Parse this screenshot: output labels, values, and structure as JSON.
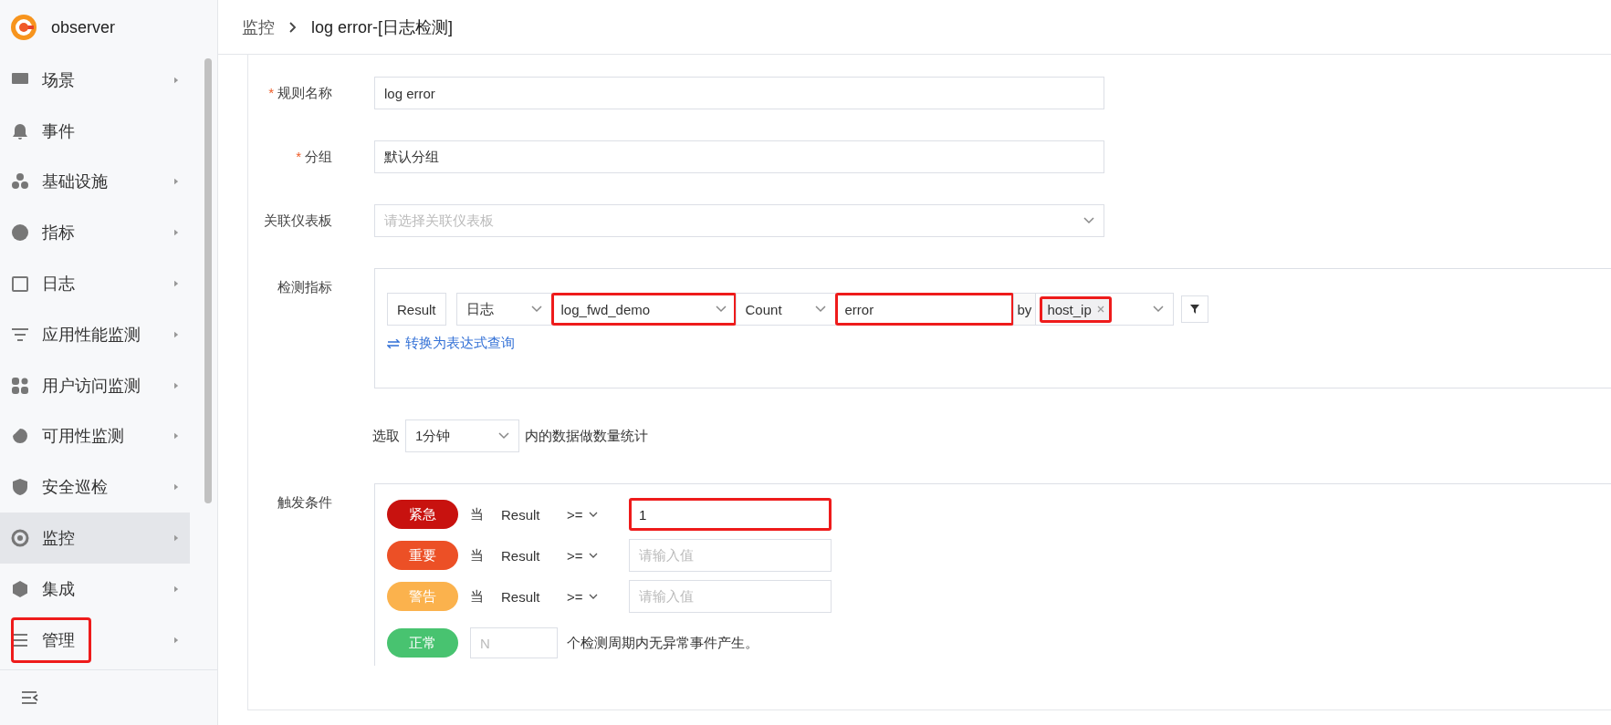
{
  "sidebar": {
    "logo_text": "observer",
    "items": [
      {
        "label": "场景",
        "has_submenu": true,
        "selected": false,
        "highlighted": false
      },
      {
        "label": "事件",
        "has_submenu": false,
        "selected": false,
        "highlighted": false
      },
      {
        "label": "基础设施",
        "has_submenu": true,
        "selected": false,
        "highlighted": false
      },
      {
        "label": "指标",
        "has_submenu": true,
        "selected": false,
        "highlighted": false
      },
      {
        "label": "日志",
        "has_submenu": true,
        "selected": false,
        "highlighted": false
      },
      {
        "label": "应用性能监测",
        "has_submenu": true,
        "selected": false,
        "highlighted": false
      },
      {
        "label": "用户访问监测",
        "has_submenu": true,
        "selected": false,
        "highlighted": false
      },
      {
        "label": "可用性监测",
        "has_submenu": true,
        "selected": false,
        "highlighted": false
      },
      {
        "label": "安全巡检",
        "has_submenu": true,
        "selected": false,
        "highlighted": false
      },
      {
        "label": "监控",
        "has_submenu": true,
        "selected": true,
        "highlighted": false
      },
      {
        "label": "集成",
        "has_submenu": true,
        "selected": false,
        "highlighted": false
      },
      {
        "label": "管理",
        "has_submenu": true,
        "selected": false,
        "highlighted": true
      }
    ]
  },
  "breadcrumb": [
    "监控",
    "log error-[日志检测]"
  ],
  "form": {
    "fields": [
      {
        "label": "规则名称",
        "required_mark": "*",
        "kind": "text",
        "value": "log error"
      },
      {
        "label": "分组",
        "required_mark": "*",
        "kind": "text",
        "value": "默认分组"
      },
      {
        "label": "关联仪表板",
        "kind": "select",
        "placeholder": "请选择关联仪表板"
      }
    ],
    "metric": {
      "label": "检测指标",
      "result": "Result",
      "source": "日志",
      "index": {
        "value": "log_fwd_demo",
        "highlighted": true
      },
      "aggregation": "Count",
      "query": {
        "value": "error",
        "highlighted": true
      },
      "by_label": "by",
      "by_tags": [
        {
          "text": "host_ip",
          "highlighted": true
        }
      ],
      "switch_link": "转换为表达式查询"
    },
    "window": {
      "prefix": "选取",
      "value": "1分钟",
      "suffix": "内的数据做数量统计"
    },
    "trigger": {
      "label": "触发条件",
      "rows": [
        {
          "kind": "threshold",
          "level": "紧急",
          "color": "#c8120f",
          "when": "当",
          "metric": "Result",
          "operator": ">=",
          "value": "1",
          "highlighted": true
        },
        {
          "kind": "threshold",
          "level": "重要",
          "color": "#ec5026",
          "when": "当",
          "metric": "Result",
          "operator": ">=",
          "placeholder": "请输入值",
          "highlighted": false
        },
        {
          "kind": "threshold",
          "level": "警告",
          "color": "#fbb24d",
          "when": "当",
          "metric": "Result",
          "operator": ">=",
          "placeholder": "请输入值",
          "highlighted": false
        },
        {
          "kind": "normal",
          "level": "正常",
          "color": "#48c370",
          "placeholder": "N",
          "suffix": "个检测周期内无异常事件产生。"
        }
      ]
    }
  }
}
